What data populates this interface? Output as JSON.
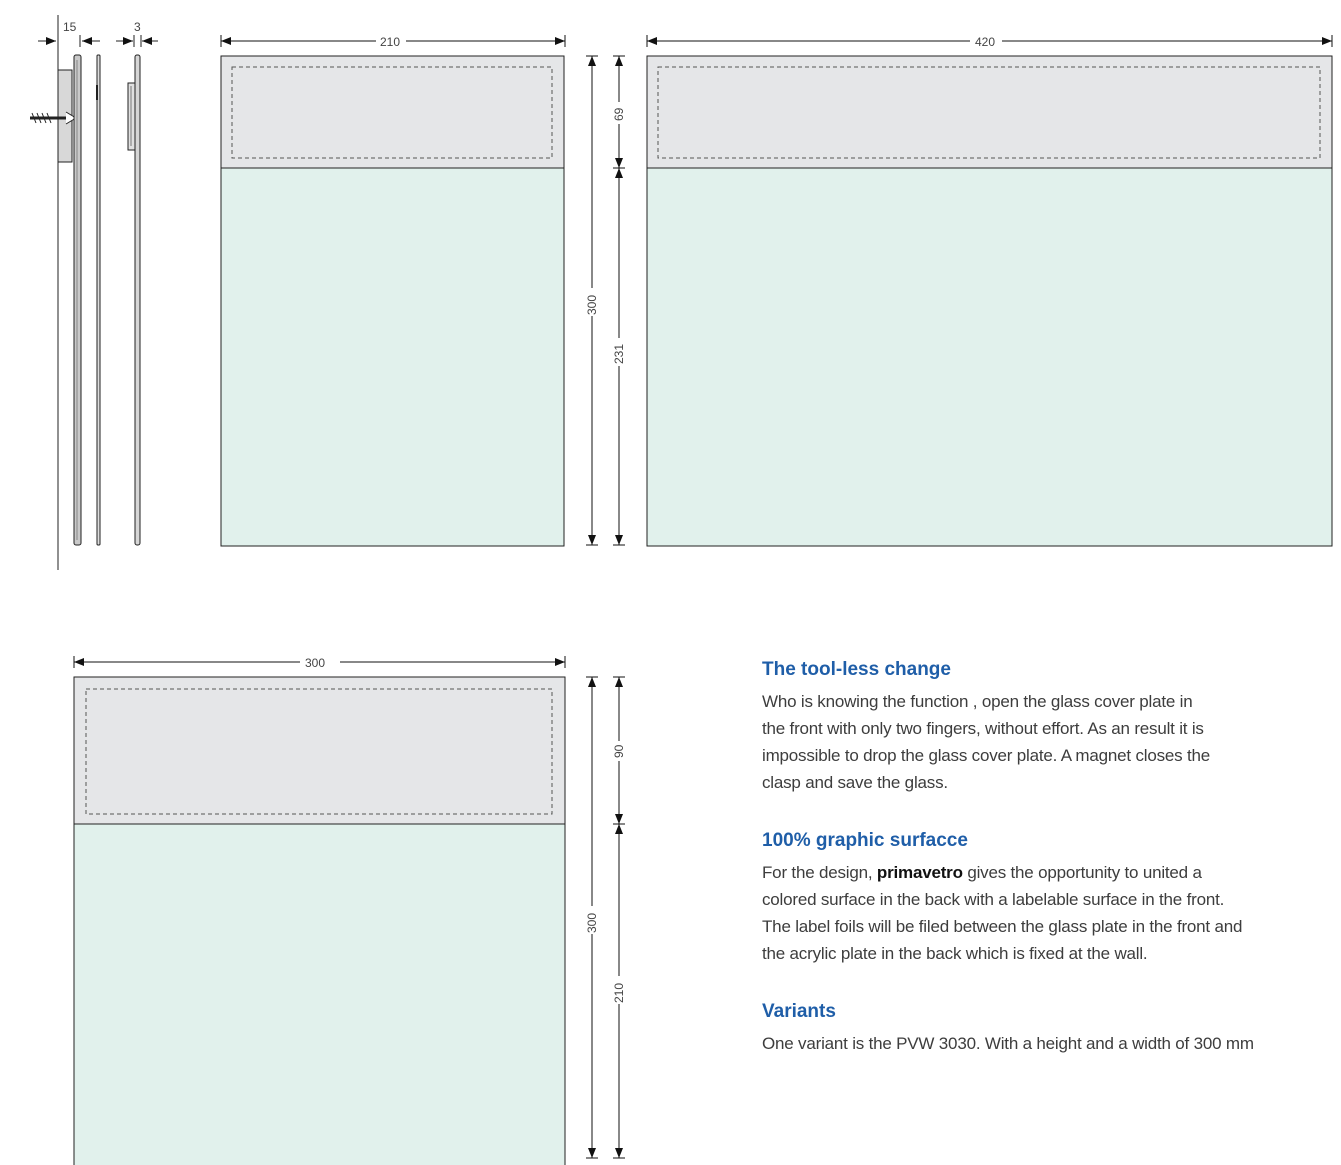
{
  "drawings": {
    "side_view": {
      "dimension_wall_offset": "15",
      "dimension_thickness": "3"
    },
    "sign_a4": {
      "width": "210",
      "total_height": "300",
      "top_height": "69",
      "bottom_height": "231"
    },
    "sign_a3": {
      "width": "420"
    },
    "sign_square": {
      "width": "300",
      "total_height": "300",
      "top_height": "90",
      "bottom_height": "210"
    }
  },
  "colors": {
    "top_panel": "#e5e6e8",
    "graphic_panel": "#e1f1ec",
    "heading": "#1f5ea8"
  },
  "sections": [
    {
      "heading": "The tool-less change",
      "lines": [
        "Who is knowing the function , open the glass cover plate in",
        "the front with only two fingers, without effort. As an result it is",
        "impossible to drop the glass cover plate. A magnet closes the",
        "clasp and save the glass."
      ]
    },
    {
      "heading": "100% graphic surfacce",
      "line1_before": "For the design, ",
      "brand": "primavetro",
      "line1_after": " gives the opportunity to united a",
      "lines": [
        "colored surface in the back with a labelable surface in the front.",
        "The label foils will be filed between the glass plate in the front and",
        "the acrylic plate in the back which is fixed at the wall."
      ]
    },
    {
      "heading": "Variants",
      "lines": [
        "One variant is the PVW 3030. With a height and a width of 300 mm"
      ]
    }
  ]
}
